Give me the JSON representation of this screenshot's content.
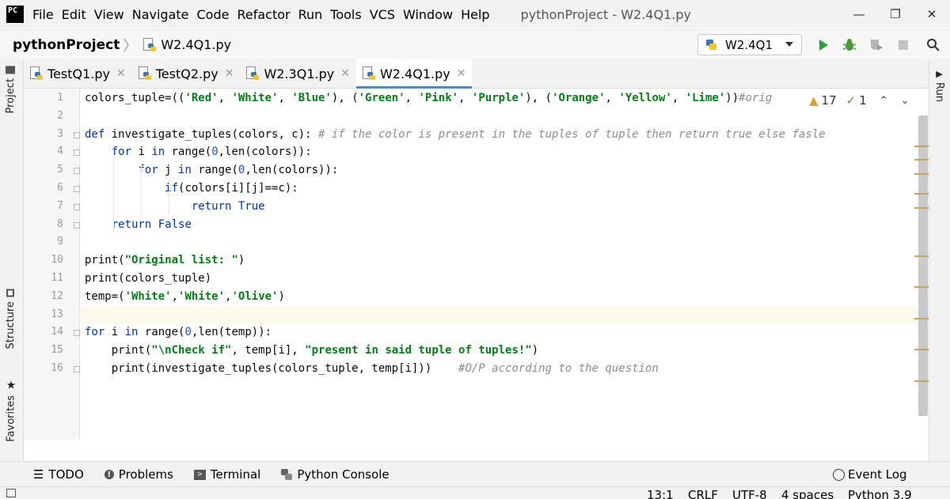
{
  "menubar": {
    "logo_text": "PC",
    "items": [
      "File",
      "Edit",
      "View",
      "Navigate",
      "Code",
      "Refactor",
      "Run",
      "Tools",
      "VCS",
      "Window",
      "Help"
    ],
    "window_title": "pythonProject - W2.4Q1.py"
  },
  "navbar": {
    "project": "pythonProject",
    "file": "W2.4Q1.py",
    "run_config": "W2.4Q1"
  },
  "tool_windows": {
    "project": "Project",
    "structure": "Structure",
    "favorites": "Favorites",
    "run": "Run"
  },
  "tabs": [
    {
      "label": "TestQ1.py",
      "active": false
    },
    {
      "label": "TestQ2.py",
      "active": false
    },
    {
      "label": "W2.3Q1.py",
      "active": false
    },
    {
      "label": "W2.4Q1.py",
      "active": true
    }
  ],
  "inspections": {
    "warnings": "17",
    "weak_warnings": "1"
  },
  "editor": {
    "current_line": 13,
    "lines": [
      "colors_tuple=(('Red', 'White', 'Blue'), ('Green', 'Pink', 'Purple'), ('Orange', 'Yellow', 'Lime'))#orig",
      "",
      "def investigate_tuples(colors, c): # if the color is present in the tuples of tuple then return true else fasle",
      "    for i in range(0,len(colors)):",
      "        for j in range(0,len(colors)):",
      "            if(colors[i][j]==c):",
      "                return True",
      "    return False",
      "",
      "print(\"Original list: \")",
      "print(colors_tuple)",
      "temp=('White','White','Olive')",
      "",
      "for i in range(0,len(temp)):",
      "    print(\"\\nCheck if\", temp[i], \"present in said tuple of tuples!\")",
      "    print(investigate_tuples(colors_tuple, temp[i]))    #O/P according to the question"
    ]
  },
  "bottom_tabs": {
    "todo": "TODO",
    "problems": "Problems",
    "terminal": "Terminal",
    "python_console": "Python Console",
    "event_log": "Event Log"
  },
  "status": {
    "position": "13:1",
    "line_sep": "CRLF",
    "encoding": "UTF-8",
    "indent": "4 spaces",
    "interpreter": "Python 3.9"
  },
  "colors": {
    "accent": "#4a88c7",
    "keyword": "#0033b3",
    "string": "#067d17",
    "comment": "#8c8c8c",
    "run_green": "#2aa33a"
  }
}
